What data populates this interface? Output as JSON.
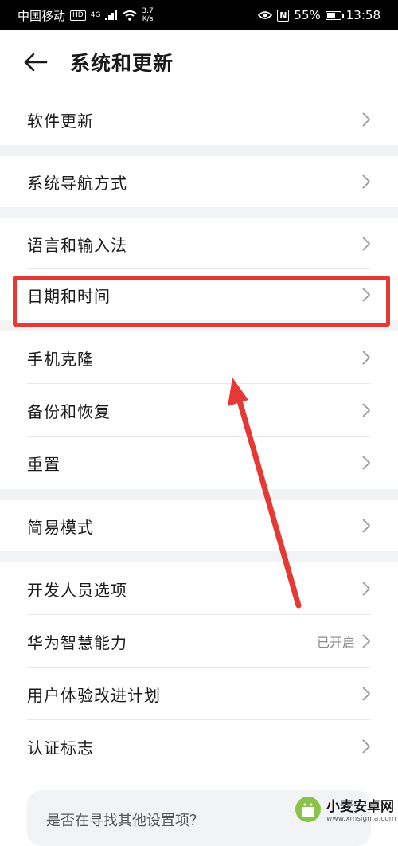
{
  "status_bar": {
    "carrier": "中国移动",
    "hd": "HD",
    "network": "4G",
    "speed_value": "3.7",
    "speed_unit": "K/s",
    "nfc": "N",
    "battery": "55%",
    "battery_level": 0.55,
    "time": "13:58"
  },
  "header": {
    "title": "系统和更新"
  },
  "menu": {
    "software_update": "软件更新",
    "nav_mode": "系统导航方式",
    "language_input": "语言和输入法",
    "date_time": "日期和时间",
    "phone_clone": "手机克隆",
    "backup_restore": "备份和恢复",
    "reset": "重置",
    "simple_mode": "简易模式",
    "developer_options": "开发人员选项",
    "huawei_ai": "华为智慧能力",
    "huawei_ai_status": "已开启",
    "ux_program": "用户体验改进计划",
    "certification": "认证标志"
  },
  "search_card": {
    "text": "是否在寻找其他设置项？"
  },
  "watermark": {
    "title": "小麦安卓网",
    "url": "www.xmsigma.com"
  },
  "annotation_color": "#e53935"
}
